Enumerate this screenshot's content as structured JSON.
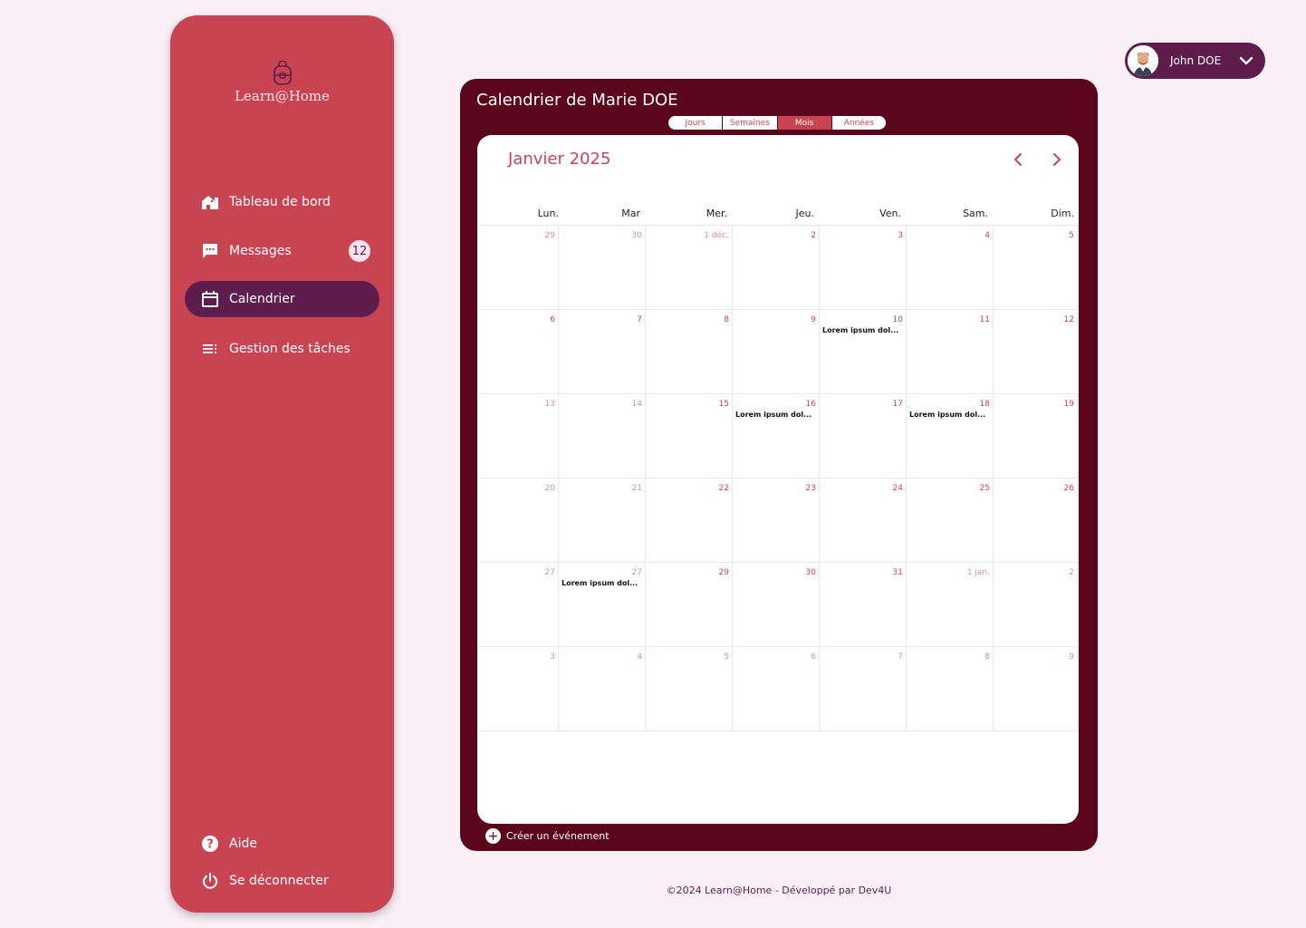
{
  "app": {
    "logo_text": "Learn@Home"
  },
  "sidebar": {
    "items": [
      {
        "label": "Tableau de bord",
        "icon": "home-icon"
      },
      {
        "label": "Messages",
        "icon": "chat-icon",
        "badge": "12"
      },
      {
        "label": "Calendrier",
        "icon": "calendar-icon",
        "active": true
      },
      {
        "label": "Gestion des tâches",
        "icon": "list-icon"
      }
    ],
    "bottom": [
      {
        "label": "Aide",
        "icon": "help-icon"
      },
      {
        "label": "Se déconnecter",
        "icon": "power-icon"
      }
    ]
  },
  "user": {
    "name": "John DOE"
  },
  "calendar": {
    "title": "Calendrier de Marie DOE",
    "views": [
      "Jours",
      "Semaines",
      "Mois",
      "Années"
    ],
    "active_view": "Mois",
    "month_label": "Janvier 2025",
    "weekdays": [
      "Lun.",
      "Mar",
      "Mer.",
      "Jeu.",
      "Ven.",
      "Sam.",
      "Dim."
    ],
    "weeks": [
      [
        {
          "d": "29",
          "m": true
        },
        {
          "d": "30",
          "m": true
        },
        {
          "d": "1 déc.",
          "m": true
        },
        {
          "d": "2"
        },
        {
          "d": "3"
        },
        {
          "d": "4"
        },
        {
          "d": "5"
        }
      ],
      [
        {
          "d": "6"
        },
        {
          "d": "7"
        },
        {
          "d": "8"
        },
        {
          "d": "9"
        },
        {
          "d": "10",
          "e": "Lorem ipsum dol..."
        },
        {
          "d": "11"
        },
        {
          "d": "12"
        }
      ],
      [
        {
          "d": "13",
          "m": true
        },
        {
          "d": "14",
          "m": true
        },
        {
          "d": "15"
        },
        {
          "d": "16",
          "e": "Lorem ipsum dol..."
        },
        {
          "d": "17"
        },
        {
          "d": "18",
          "e": "Lorem ipsum dol..."
        },
        {
          "d": "19"
        }
      ],
      [
        {
          "d": "20",
          "m": true
        },
        {
          "d": "21",
          "m": true
        },
        {
          "d": "22"
        },
        {
          "d": "23"
        },
        {
          "d": "24"
        },
        {
          "d": "25"
        },
        {
          "d": "26"
        }
      ],
      [
        {
          "d": "27",
          "m": true
        },
        {
          "d": "27",
          "m": true,
          "e": "Lorem ipsum dol..."
        },
        {
          "d": "29"
        },
        {
          "d": "30"
        },
        {
          "d": "31"
        },
        {
          "d": "1 jan.",
          "m": true
        },
        {
          "d": "2",
          "m": true
        }
      ],
      [
        {
          "d": "3",
          "m": true
        },
        {
          "d": "4",
          "m": true
        },
        {
          "d": "5",
          "m": true
        },
        {
          "d": "6",
          "m": true
        },
        {
          "d": "7",
          "m": true
        },
        {
          "d": "8",
          "m": true
        },
        {
          "d": "9",
          "m": true
        }
      ]
    ],
    "create_label": "Créer un événement"
  },
  "footer": {
    "text": "©2024 Learn@Home - Développé par Dev4U"
  },
  "colors": {
    "primary": "#c84452",
    "dark": "#5a0519",
    "accent": "#5e1d4c",
    "background": "#fcf0f7"
  }
}
